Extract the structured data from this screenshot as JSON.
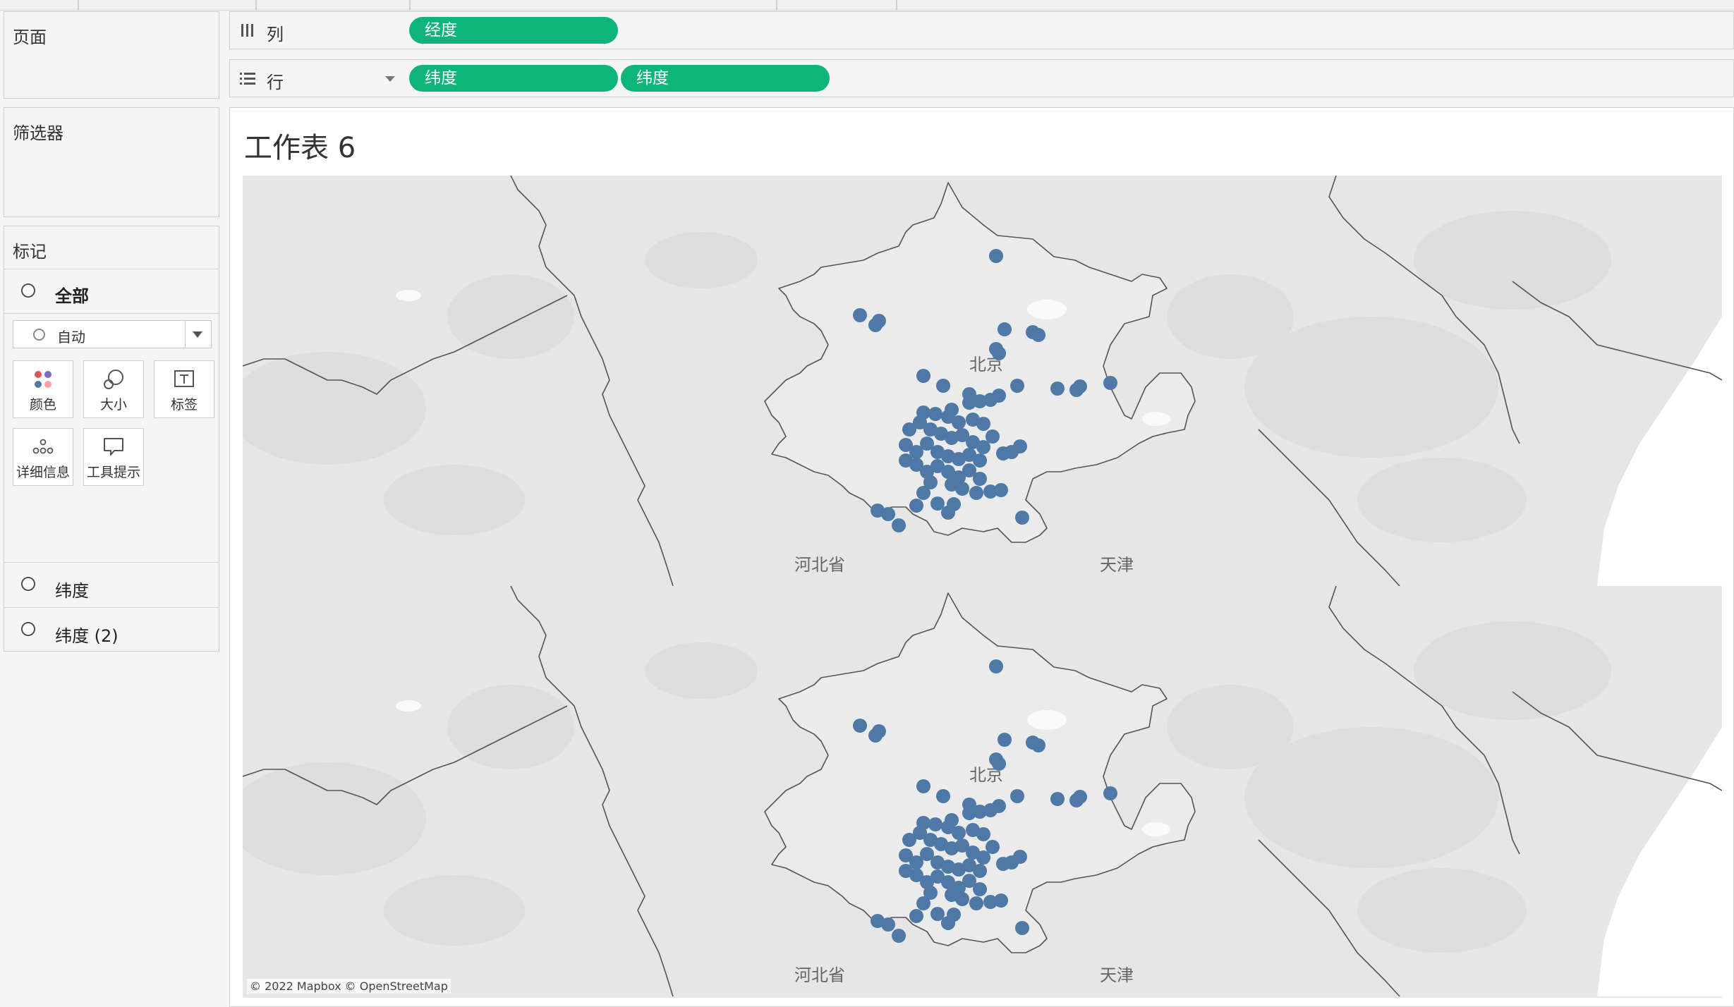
{
  "panels": {
    "pages": {
      "title": "页面"
    },
    "filters": {
      "title": "筛选器"
    },
    "marks": {
      "title": "标记",
      "all_label": "全部",
      "mark_type": "自动",
      "tiles": [
        {
          "label": "颜色",
          "icon": "color-icon"
        },
        {
          "label": "大小",
          "icon": "size-icon"
        },
        {
          "label": "标签",
          "icon": "label-icon"
        },
        {
          "label": "详细信息",
          "icon": "detail-icon"
        },
        {
          "label": "工具提示",
          "icon": "tooltip-icon"
        }
      ],
      "layers": [
        {
          "label": "纬度"
        },
        {
          "label": "纬度 (2)"
        }
      ]
    }
  },
  "shelves": {
    "columns": {
      "label": "列",
      "icon": "columns-icon",
      "pills": [
        "经度"
      ]
    },
    "rows": {
      "label": "行",
      "icon": "rows-icon",
      "pills": [
        "纬度",
        "纬度"
      ]
    }
  },
  "sheet": {
    "title": "工作表 6"
  },
  "map": {
    "labels": {
      "beijing": "北京",
      "hebei": "河北省",
      "tianjin": "天津"
    },
    "attribution": "© 2022 Mapbox © OpenStreetMap",
    "mark_color": "#4e79a7",
    "pill_color": "#0fb47b"
  }
}
